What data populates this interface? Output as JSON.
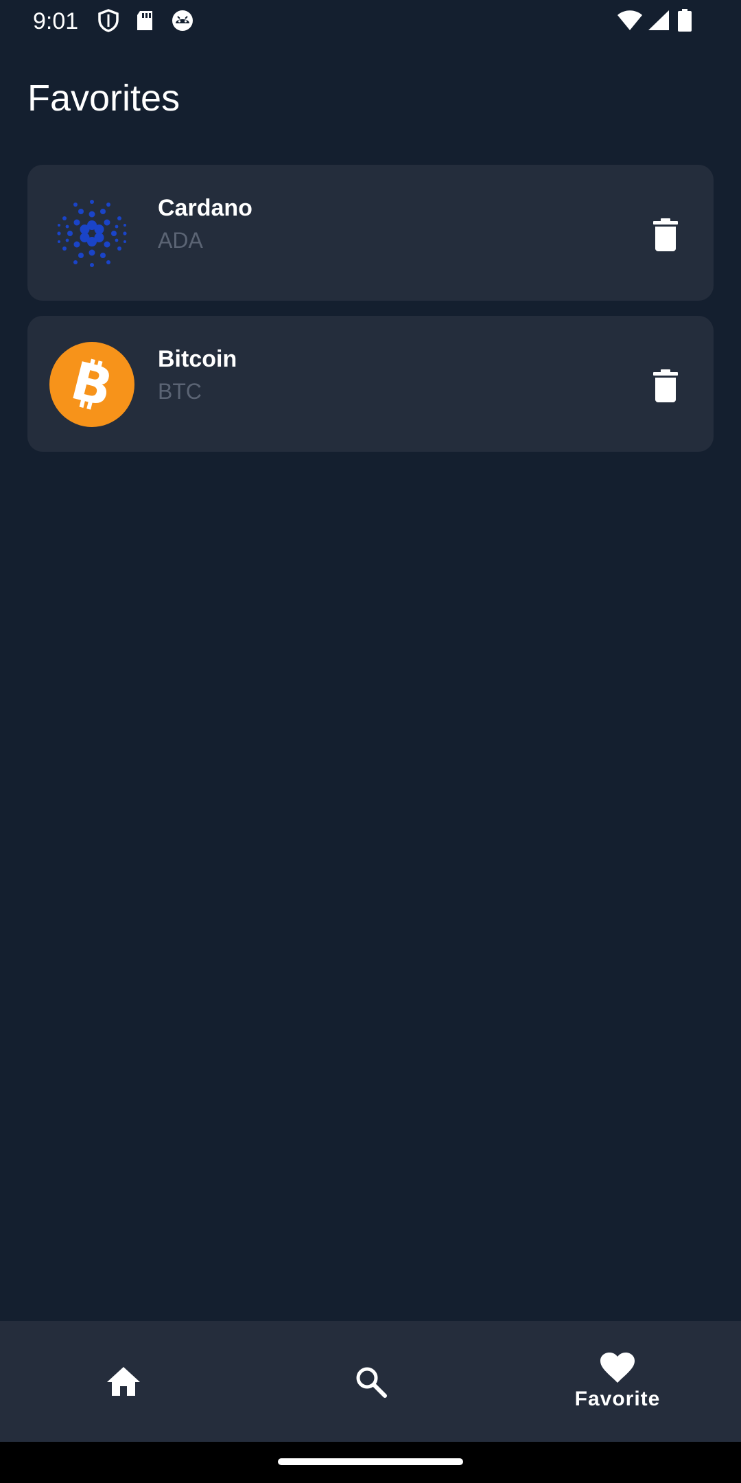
{
  "status_bar": {
    "time": "9:01",
    "icons": [
      "shield-icon",
      "sd-card-icon",
      "android-debug-icon",
      "wifi-icon",
      "signal-icon",
      "battery-icon"
    ]
  },
  "header": {
    "title": "Favorites"
  },
  "favorites": [
    {
      "name": "Cardano",
      "symbol": "ADA",
      "logo": "cardano-logo",
      "action": "trash-icon"
    },
    {
      "name": "Bitcoin",
      "symbol": "BTC",
      "logo": "bitcoin-logo",
      "action": "trash-icon"
    }
  ],
  "bottom_nav": {
    "items": [
      {
        "icon": "home-icon",
        "label": ""
      },
      {
        "icon": "search-icon",
        "label": ""
      },
      {
        "icon": "heart-icon",
        "label": "Favorite",
        "active": true
      }
    ]
  },
  "colors": {
    "background": "#141f2f",
    "card": "#242d3c",
    "nav": "#252d3c",
    "symbol_text": "#5b6474",
    "bitcoin_orange": "#f7931a",
    "cardano_blue": "#1a44c8"
  }
}
